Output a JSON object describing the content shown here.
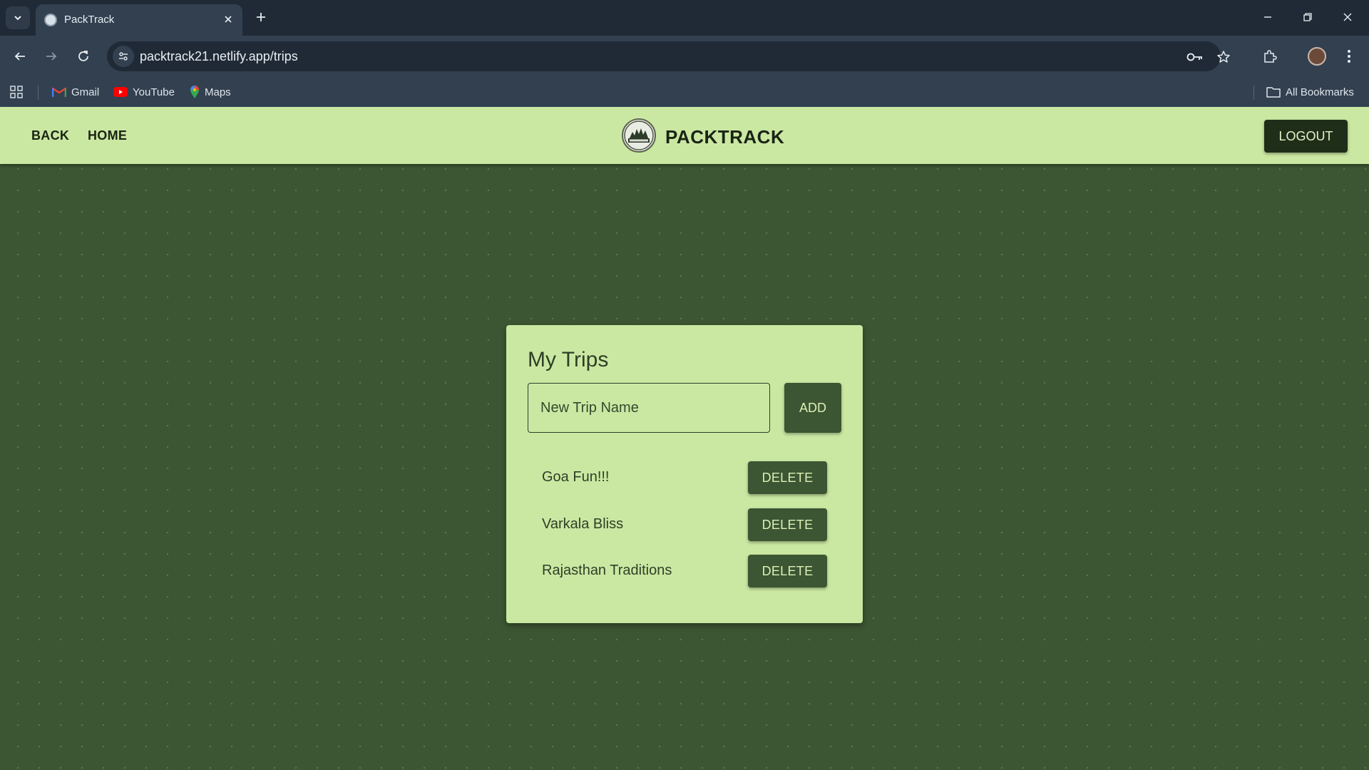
{
  "browser": {
    "tab_title": "PackTrack",
    "url": "packtrack21.netlify.app/trips",
    "bookmarks": [
      {
        "label": "Gmail",
        "icon": "gmail-icon"
      },
      {
        "label": "YouTube",
        "icon": "youtube-icon"
      },
      {
        "label": "Maps",
        "icon": "maps-icon"
      }
    ],
    "all_bookmarks_label": "All Bookmarks"
  },
  "header": {
    "back_label": "BACK",
    "home_label": "HOME",
    "brand_name": "PACKTRACK",
    "logout_label": "LOGOUT"
  },
  "trips_card": {
    "title": "My Trips",
    "input_placeholder": "New Trip Name",
    "input_value": "",
    "add_label": "ADD",
    "delete_label": "DELETE",
    "trips": [
      {
        "name": "Goa Fun!!!"
      },
      {
        "name": "Varkala Bliss"
      },
      {
        "name": "Rajasthan Traditions"
      }
    ]
  },
  "colors": {
    "header_bg": "#cbe8a3",
    "page_bg": "#3c5532",
    "button_bg": "#3c5532",
    "logout_bg": "#1f2e18"
  }
}
